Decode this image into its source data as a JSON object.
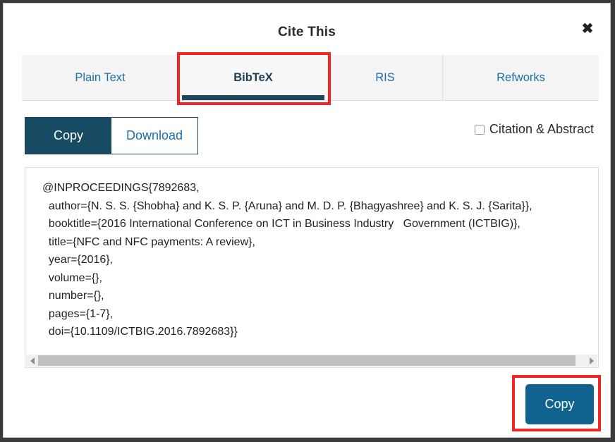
{
  "modal": {
    "title": "Cite This",
    "close_icon": "close-icon"
  },
  "tabs": [
    {
      "label": "Plain Text",
      "active": false
    },
    {
      "label": "BibTeX",
      "active": true
    },
    {
      "label": "RIS",
      "active": false
    },
    {
      "label": "Refworks",
      "active": false
    }
  ],
  "actions": {
    "copy_label": "Copy",
    "download_label": "Download",
    "abstract_label": "Citation & Abstract",
    "abstract_checked": false
  },
  "citation": {
    "format": "BibTeX",
    "lines": [
      "@INPROCEEDINGS{7892683,",
      "author={N. S. S. {Shobha} and K. S. P. {Aruna} and M. D. P. {Bhagyashree} and K. S. J. {Sarita}},",
      "booktitle={2016 International Conference on ICT in Business Industry   Government (ICTBIG)},",
      "title={NFC and NFC payments: A review},",
      "year={2016},",
      "volume={},",
      "number={},",
      "pages={1-7},",
      "doi={10.1109/ICTBIG.2016.7892683}}"
    ],
    "text": "@INPROCEEDINGS{7892683,\n  author={N. S. S. {Shobha} and K. S. P. {Aruna} and M. D. P. {Bhagyashree} and K. S. J. {Sarita}},\n  booktitle={2016 International Conference on ICT in Business Industry   Government (ICTBIG)},\n  title={NFC and NFC payments: A review},\n  year={2016},\n  volume={},\n  number={},\n  pages={1-7},\n  doi={10.1109/ICTBIG.2016.7892683}}"
  },
  "scrollbar": {
    "left_arrow_icon": "chevron-left-icon",
    "right_arrow_icon": "chevron-right-icon",
    "thumb_fraction": "98"
  },
  "footer": {
    "copy_label": "Copy"
  },
  "colors": {
    "accent_dark": "#174a63",
    "accent_blue": "#10628f",
    "link_blue": "#1a6fa8",
    "highlight_red": "#f42525",
    "tabbar_bg": "#f4f4f4"
  }
}
